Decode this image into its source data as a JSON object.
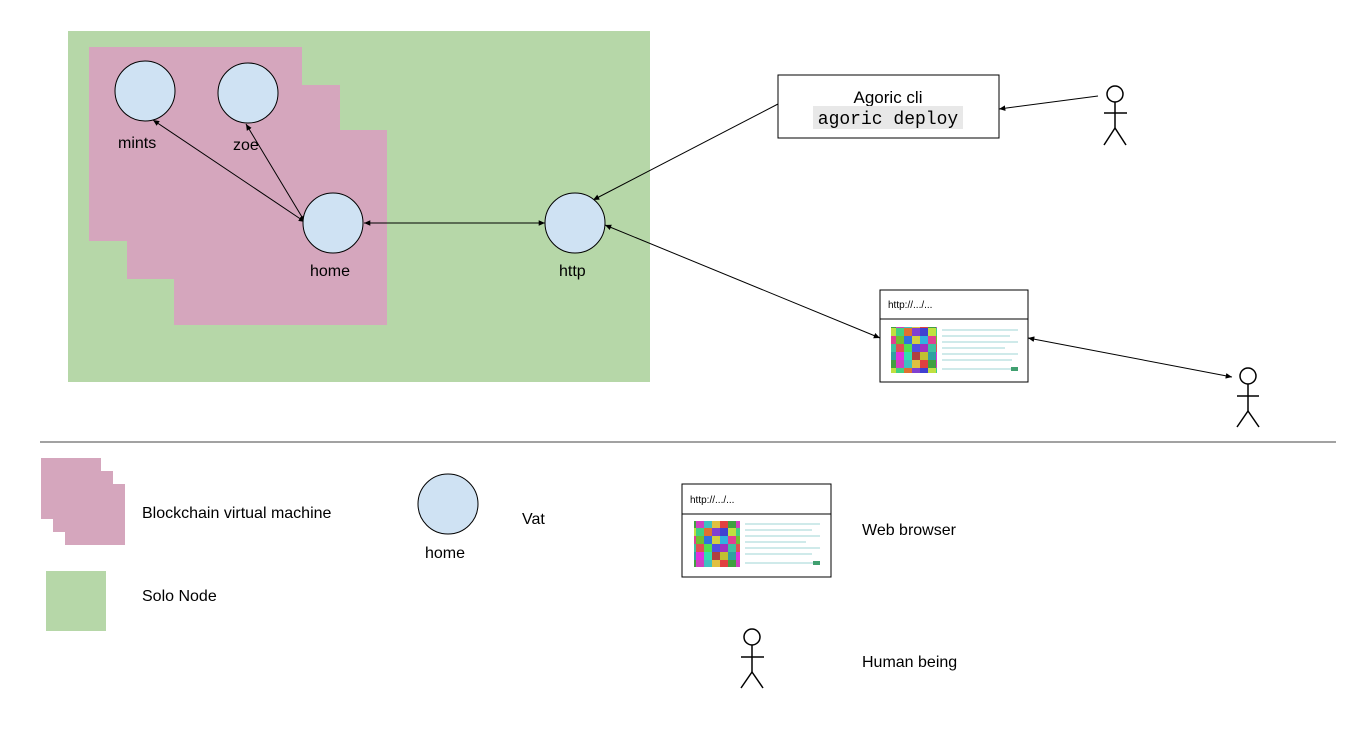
{
  "colors": {
    "blockchain_vm": "#d5a6bd",
    "solo_node": "#b6d7a8",
    "vat": "#cfe2f3",
    "code_highlight": "#e8e8e8"
  },
  "diagram": {
    "vats": {
      "mints": "mints",
      "zoe": "zoe",
      "home": "home",
      "http": "http"
    },
    "cli_box": {
      "title": "Agoric cli",
      "command": "agoric deploy"
    },
    "browser": {
      "url": "http://.../..."
    }
  },
  "legend": {
    "blockchain_vm": "Blockchain virtual machine",
    "solo_node": "Solo Node",
    "vat_circle_label": "home",
    "vat": "Vat",
    "browser_url": "http://.../...",
    "web_browser": "Web browser",
    "human_being": "Human being"
  }
}
